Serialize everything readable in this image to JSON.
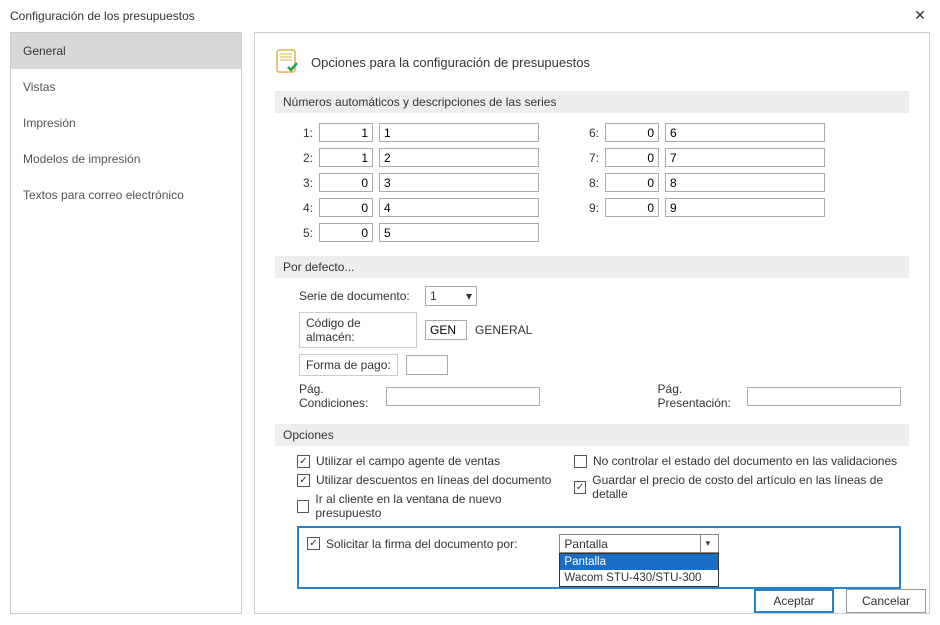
{
  "window": {
    "title": "Configuración de los presupuestos"
  },
  "sidebar": {
    "items": [
      {
        "label": "General",
        "selected": true
      },
      {
        "label": "Vistas"
      },
      {
        "label": "Impresión"
      },
      {
        "label": "Modelos de impresión"
      },
      {
        "label": "Textos para correo electrónico"
      }
    ]
  },
  "header": {
    "title": "Opciones para la configuración de presupuestos"
  },
  "sections": {
    "series_title": "Números automáticos y descripciones de las series",
    "defaults_title": "Por defecto...",
    "options_title": "Opciones"
  },
  "series": [
    {
      "n": "1:",
      "num": "1",
      "desc": "1"
    },
    {
      "n": "2:",
      "num": "1",
      "desc": "2"
    },
    {
      "n": "3:",
      "num": "0",
      "desc": "3"
    },
    {
      "n": "4:",
      "num": "0",
      "desc": "4"
    },
    {
      "n": "5:",
      "num": "0",
      "desc": "5"
    },
    {
      "n": "6:",
      "num": "0",
      "desc": "6"
    },
    {
      "n": "7:",
      "num": "0",
      "desc": "7"
    },
    {
      "n": "8:",
      "num": "0",
      "desc": "8"
    },
    {
      "n": "9:",
      "num": "0",
      "desc": "9"
    }
  ],
  "defaults": {
    "serie_label": "Serie de documento:",
    "serie_value": "1",
    "almacen_label": "Código de almacén:",
    "almacen_code": "GEN",
    "almacen_name": "GENERAL",
    "pago_label": "Forma de pago:",
    "pago_value": "",
    "pag_cond_label": "Pág. Condiciones:",
    "pag_pres_label": "Pág. Presentación:"
  },
  "options": {
    "left": [
      {
        "label": "Utilizar el campo agente de ventas",
        "checked": true
      },
      {
        "label": "Utilizar descuentos en líneas del documento",
        "checked": true
      },
      {
        "label": "Ir al cliente en la ventana de nuevo presupuesto",
        "checked": false
      }
    ],
    "right": [
      {
        "label": "No controlar el estado del documento en las validaciones",
        "checked": false
      },
      {
        "label": "Guardar el precio de costo del artículo en las líneas de detalle",
        "checked": true
      }
    ],
    "firma": {
      "label": "Solicitar la firma del documento por:",
      "checked": true,
      "value": "Pantalla",
      "items": [
        "Pantalla",
        "Wacom STU-430/STU-300"
      ]
    }
  },
  "footer": {
    "accept": "Aceptar",
    "cancel": "Cancelar"
  }
}
